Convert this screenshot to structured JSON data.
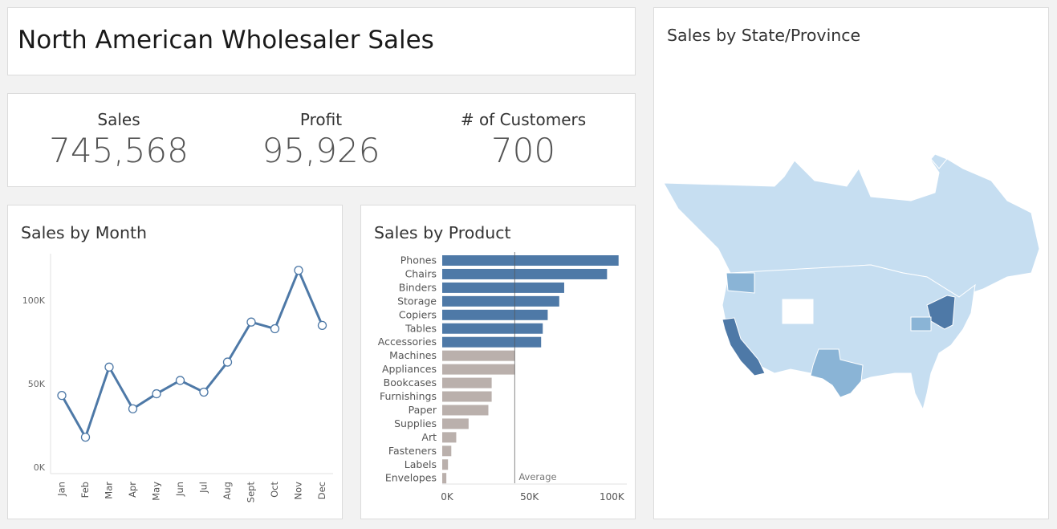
{
  "dashboard": {
    "title": "North American Wholesaler Sales"
  },
  "kpis": [
    {
      "label": "Sales",
      "value": "745,568"
    },
    {
      "label": "Profit",
      "value": "95,926"
    },
    {
      "label": "# of Customers",
      "value": "700"
    }
  ],
  "colors": {
    "blue": "#4e79a7",
    "gray": "#bab0ac",
    "map_light": "#c6def1",
    "map_mid": "#8ab4d6",
    "map_dark": "#4e79a7"
  },
  "chart_data": [
    {
      "type": "line",
      "title": "Sales by Month",
      "categories": [
        "Jan",
        "Feb",
        "Mar",
        "Apr",
        "May",
        "Jun",
        "Jul",
        "Aug",
        "Sept",
        "Oct",
        "Nov",
        "Dec"
      ],
      "series": [
        {
          "values": [
            43000,
            18000,
            60000,
            35000,
            44000,
            52000,
            45000,
            63000,
            87000,
            83000,
            118000,
            85000
          ]
        }
      ],
      "ylim": [
        0,
        128000
      ],
      "yticks": [
        0,
        50000,
        100000
      ],
      "ytick_labels": [
        "0K",
        "50K",
        "100K"
      ],
      "grid": false
    },
    {
      "type": "bar",
      "orientation": "horizontal",
      "title": "Sales by Product",
      "categories": [
        "Phones",
        "Chairs",
        "Binders",
        "Storage",
        "Copiers",
        "Tables",
        "Accessories",
        "Machines",
        "Appliances",
        "Bookcases",
        "Furnishings",
        "Paper",
        "Supplies",
        "Art",
        "Fasteners",
        "Labels",
        "Envelopes"
      ],
      "values": [
        107000,
        100000,
        74000,
        71000,
        64000,
        61000,
        60000,
        44000,
        44000,
        30000,
        30000,
        28000,
        16000,
        8500,
        5500,
        3500,
        2500
      ],
      "reference_line": {
        "label": "Average",
        "value": 44000
      },
      "xlim": [
        0,
        112000
      ],
      "xticks": [
        0,
        50000,
        100000
      ],
      "xtick_labels": [
        "0K",
        "50K",
        "100K"
      ]
    },
    {
      "type": "map",
      "title": "Sales by State/Province",
      "region": "North America (USA and Canada)",
      "highlighted": [
        {
          "state": "California",
          "level": "high"
        },
        {
          "state": "New York",
          "level": "high"
        },
        {
          "state": "Texas",
          "level": "medium"
        },
        {
          "state": "Washington",
          "level": "medium"
        },
        {
          "state": "Pennsylvania",
          "level": "medium"
        }
      ]
    }
  ]
}
